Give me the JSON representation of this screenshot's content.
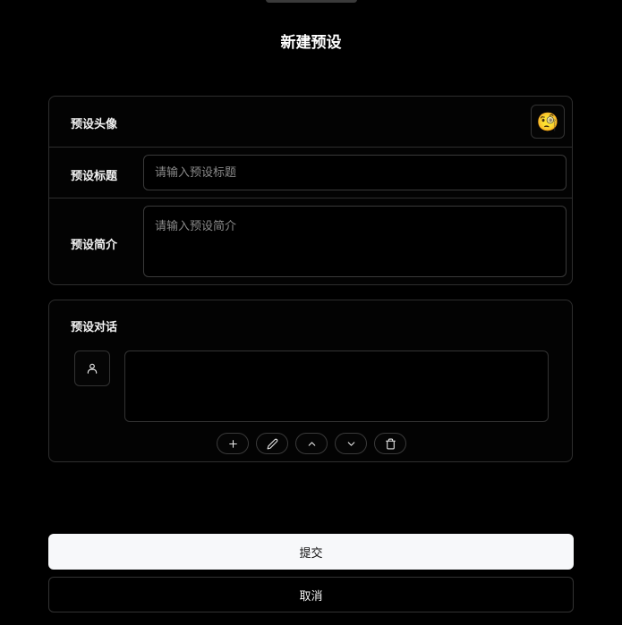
{
  "dialog": {
    "title": "新建预设"
  },
  "form": {
    "avatar": {
      "label": "预设头像",
      "emoji": "🧐"
    },
    "title_field": {
      "label": "预设标题",
      "placeholder": "请输入预设标题",
      "value": ""
    },
    "description_field": {
      "label": "预设简介",
      "placeholder": "请输入预设简介",
      "value": ""
    }
  },
  "conversation": {
    "label": "预设对话",
    "messages": [
      {
        "role_icon": "user-icon",
        "content": ""
      }
    ],
    "actions": [
      "plus-icon",
      "pencil-icon",
      "chevron-up-icon",
      "chevron-down-icon",
      "trash-icon"
    ]
  },
  "footer": {
    "submit_label": "提交",
    "cancel_label": "取消"
  },
  "colors": {
    "background": "#000000",
    "border": "#2e2e2e",
    "submit_bg": "#f7f8fa"
  }
}
